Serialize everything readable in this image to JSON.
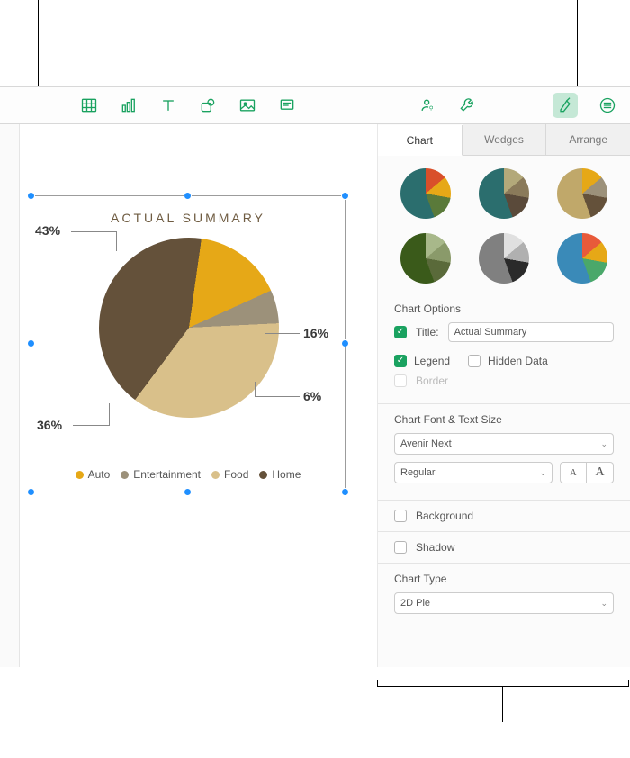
{
  "toolbar": {
    "icons": [
      "table-icon",
      "bar-chart-icon",
      "text-icon",
      "shape-icon",
      "image-icon",
      "comment-icon",
      "collaborate-icon",
      "wrench-icon",
      "format-icon",
      "more-icon"
    ]
  },
  "chart_data": {
    "type": "pie",
    "title": "ACTUAL SUMMARY",
    "categories": [
      "Auto",
      "Entertainment",
      "Food",
      "Home"
    ],
    "values": [
      16,
      6,
      36,
      43
    ],
    "colors": {
      "Auto": "#e6a817",
      "Entertainment": "#9c917a",
      "Food": "#d9c08a",
      "Home": "#64513a"
    },
    "data_labels": [
      "16%",
      "6%",
      "36%",
      "43%"
    ],
    "legend_position": "bottom"
  },
  "legend": {
    "items": [
      {
        "label": "Auto",
        "swatch": "#e6a817"
      },
      {
        "label": "Entertainment",
        "swatch": "#9c917a"
      },
      {
        "label": "Food",
        "swatch": "#d9c08a"
      },
      {
        "label": "Home",
        "swatch": "#64513a"
      }
    ]
  },
  "sidebar": {
    "tabs": {
      "chart": "Chart",
      "wedges": "Wedges",
      "arrange": "Arrange"
    },
    "chart_options": {
      "heading": "Chart Options",
      "title_label": "Title:",
      "title_value": "Actual Summary",
      "legend_label": "Legend",
      "hidden_data_label": "Hidden Data",
      "border_label": "Border",
      "title_checked": true,
      "legend_checked": true,
      "hidden_data_checked": false,
      "border_checked": false
    },
    "font": {
      "heading": "Chart Font & Text Size",
      "family": "Avenir Next",
      "weight": "Regular",
      "small_label": "A",
      "large_label": "A"
    },
    "background": {
      "label": "Background",
      "checked": false
    },
    "shadow": {
      "label": "Shadow",
      "checked": false
    },
    "chart_type": {
      "heading": "Chart Type",
      "value": "2D Pie"
    }
  }
}
